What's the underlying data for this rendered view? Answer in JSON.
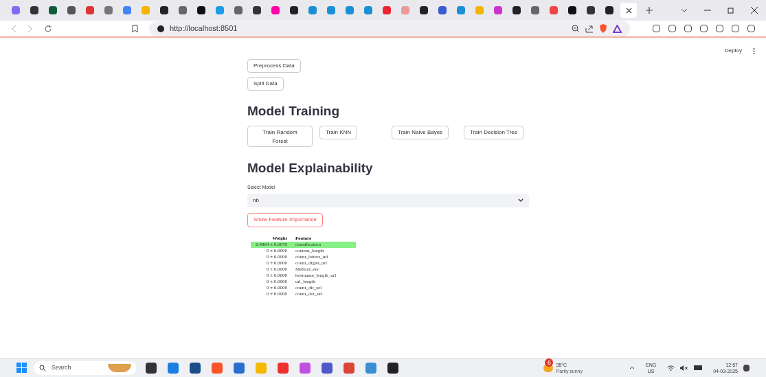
{
  "browser": {
    "url": "http://localhost:8501"
  },
  "app": {
    "deploy": "Deploy",
    "buttons": [
      "Preprocess Data",
      "Split Data"
    ],
    "training": {
      "heading": "Model Training",
      "buttons": [
        "Train Random Forest",
        "Train KNN",
        "Train Naive Bayes",
        "Train Decision Tree"
      ]
    },
    "explain": {
      "heading": "Model Explainability",
      "select_label": "Select Model",
      "select_value": "nb",
      "button": "Show Feature Importance"
    },
    "table": {
      "columns": [
        "Weight",
        "Feature"
      ],
      "rows": [
        {
          "weight": "0.4864 ± 0.0070",
          "feature": "classification",
          "highlighted": true
        },
        {
          "weight": "0 ± 0.0000",
          "feature": "content_length",
          "highlighted": false
        },
        {
          "weight": "0 ± 0.0000",
          "feature": "count_letters_url",
          "highlighted": false
        },
        {
          "weight": "0 ± 0.0000",
          "feature": "count_digits_url",
          "highlighted": false
        },
        {
          "weight": "0 ± 0.0000",
          "feature": "Method_enc",
          "highlighted": false
        },
        {
          "weight": "0 ± 0.0000",
          "feature": "hostname_length_url",
          "highlighted": false
        },
        {
          "weight": "0 ± 0.0000",
          "feature": "url_length",
          "highlighted": false
        },
        {
          "weight": "0 ± 0.0000",
          "feature": "count_dir_url",
          "highlighted": false
        },
        {
          "weight": "0 ± 0.0000",
          "feature": "count_dot_url",
          "highlighted": false
        }
      ]
    }
  },
  "taskbar": {
    "search_placeholder": "Search",
    "weather": {
      "badge": "6",
      "temp": "35°C",
      "desc": "Partly sunny"
    },
    "lang": "ENG",
    "region": "US",
    "time": "12:57",
    "date": "04-03-2025"
  }
}
